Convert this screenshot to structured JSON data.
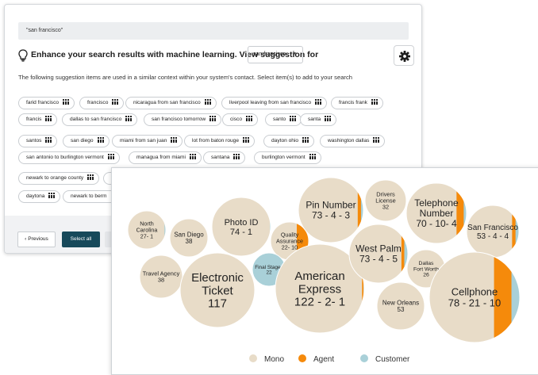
{
  "query": "\"san francisco\"",
  "enhance": {
    "text": "Enhance your search results with machine learning. View suggestion for",
    "selected": "san francisco"
  },
  "intro": "The following suggestion items are used in a similar context within your system's contact. Select item(s) to add to your search",
  "chips": [
    "farid francisco",
    "francisco",
    "nicaragua from san francisco",
    "liverpool leaving from san francisco",
    "francis frank",
    "francis",
    "dallas to san francisco",
    "san francisco tomorrow",
    "cisco",
    "santo",
    "santa",
    "santos",
    "san diego",
    "miami from san juan",
    "lot from baton rouge",
    "dayton ohio",
    "washington dallas",
    "san antonio to burlington vermont",
    "managua from miami",
    "santana",
    "burlington vermont",
    "newark to orange county",
    "",
    "daytona",
    "newark to berm"
  ],
  "footer": {
    "prev": "Previous",
    "select_all": "Select all"
  },
  "legend": [
    {
      "label": "Mono",
      "color": "#e8dcc8"
    },
    {
      "label": "Agent",
      "color": "#f58a0b"
    },
    {
      "label": "Customer",
      "color": "#a9d0d8"
    }
  ],
  "chart_data": {
    "type": "bubble",
    "bubbles": [
      {
        "name": "North Carolina",
        "value": "27- 1",
        "mono": 27,
        "agent": 0,
        "customer": 1
      },
      {
        "name": "San Diego",
        "value": "38",
        "mono": 38,
        "agent": 0,
        "customer": 0
      },
      {
        "name": "Photo ID",
        "value": "74 - 1",
        "mono": 74,
        "agent": 0,
        "customer": 1
      },
      {
        "name": "Quality Assurance",
        "value": "22- 10",
        "mono": 22,
        "agent": 10,
        "customer": 0
      },
      {
        "name": "Pin Number",
        "value": "73 - 4 - 3",
        "mono": 73,
        "agent": 4,
        "customer": 3
      },
      {
        "name": "Drivers License",
        "value": "32",
        "mono": 32,
        "agent": 0,
        "customer": 0
      },
      {
        "name": "Telephone Number",
        "value": "70 - 10- 4",
        "mono": 70,
        "agent": 10,
        "customer": 4
      },
      {
        "name": "San Francisco",
        "value": "53 - 4 - 4",
        "mono": 53,
        "agent": 4,
        "customer": 4
      },
      {
        "name": "Travel Agency",
        "value": "38",
        "mono": 38,
        "agent": 0,
        "customer": 0
      },
      {
        "name": "Final Stages",
        "value": "22",
        "mono": 0,
        "agent": 0,
        "customer": 22
      },
      {
        "name": "Electronic Ticket",
        "value": "117",
        "mono": 117,
        "agent": 0,
        "customer": 0
      },
      {
        "name": "American Express",
        "value": "122 - 2- 1",
        "mono": 122,
        "agent": 2,
        "customer": 1
      },
      {
        "name": "West Palm",
        "value": "73 - 4 - 5",
        "mono": 73,
        "agent": 4,
        "customer": 5
      },
      {
        "name": "Dallas Fort Worth",
        "value": "26",
        "mono": 26,
        "agent": 0,
        "customer": 0
      },
      {
        "name": "New Orleans",
        "value": "53",
        "mono": 53,
        "agent": 0,
        "customer": 0
      },
      {
        "name": "Cellphone",
        "value": "78 - 21 - 10",
        "mono": 78,
        "agent": 21,
        "customer": 10
      }
    ]
  }
}
